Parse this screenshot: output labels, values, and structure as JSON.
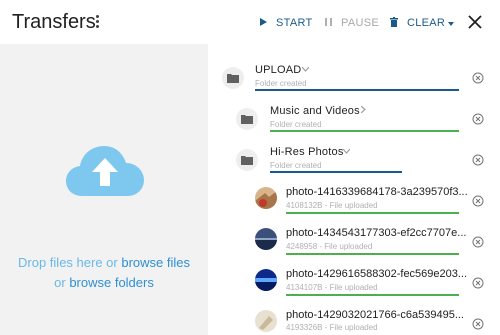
{
  "header": {
    "title": "Transfers",
    "start_label": "START",
    "pause_label": "PAUSE",
    "clear_label": "CLEAR"
  },
  "dropzone": {
    "line1_prefix": "Drop files here or ",
    "browse_files": "browse files",
    "line2_prefix": "or ",
    "browse_folders": "browse folders"
  },
  "transfers": [
    {
      "name": "UPLOAD",
      "status": "Folder created",
      "progress": 1.0,
      "bar_color": "#1a5b8c"
    },
    {
      "name": "Music and Videos",
      "status": "Folder created",
      "progress": 1.0,
      "bar_color": "#4caf50"
    },
    {
      "name": "Hi-Res Photos",
      "status": "Folder created",
      "progress": 0.7,
      "bar_color": "#1a5b8c"
    },
    {
      "name": "photo-1416339684178-3a239570f3...",
      "status": "4108132B - File uploaded",
      "progress": 1.0,
      "bar_color": "#4caf50"
    },
    {
      "name": "photo-1434543177303-ef2cc7707e...",
      "status": "4248958 - File uploaded",
      "progress": 1.0,
      "bar_color": "#4caf50"
    },
    {
      "name": "photo-1429616588302-fec569e203...",
      "status": "4134107B - File uploaded",
      "progress": 1.0,
      "bar_color": "#4caf50"
    },
    {
      "name": "photo-1429032021766-c6a539495...",
      "status": "4193326B - File uploaded",
      "progress": 1.0,
      "bar_color": "#4caf50"
    }
  ],
  "colors": {
    "accent": "#1a5b8c",
    "success": "#4caf50",
    "link": "#2e8fd4",
    "cloud": "#7ec8f0"
  },
  "icons": [
    "kebab-menu-icon",
    "play-icon",
    "pause-icon",
    "trash-icon",
    "close-icon",
    "cloud-upload-icon",
    "folder-icon",
    "chevron-down-icon",
    "chevron-right-icon",
    "cancel-circle-icon"
  ]
}
